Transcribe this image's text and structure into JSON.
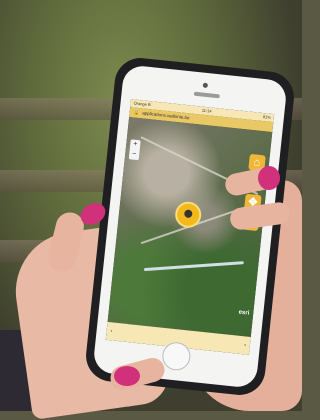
{
  "photo": {
    "subject": "phone-with-map-app"
  },
  "phone_screen": {
    "status": {
      "carrier": "Orange B",
      "time": "11:14",
      "battery": "81%"
    },
    "url": "applications.wallonie.be",
    "map_attribution": "esri",
    "controls": [
      {
        "name": "home-control",
        "symbol": "⌂"
      },
      {
        "name": "zoom-in-control",
        "symbol": "+"
      },
      {
        "name": "move-control",
        "symbol": "✥"
      },
      {
        "name": "locate-control",
        "symbol": "➤"
      }
    ],
    "zoom": {
      "plus": "+",
      "minus": "−"
    },
    "bottom_bar": {
      "left": "‹",
      "right": "›"
    }
  }
}
